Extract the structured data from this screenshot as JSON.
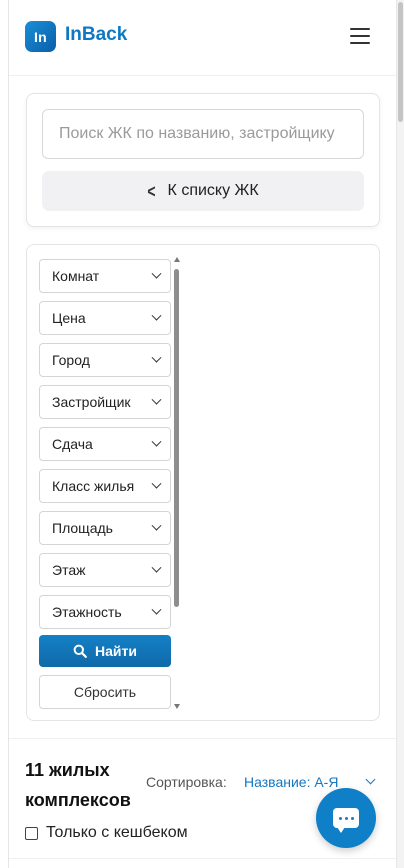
{
  "header": {
    "logo_mark": "In",
    "logo_text": "InBack"
  },
  "search": {
    "placeholder": "Поиск ЖК по названию, застройщику",
    "back_label": "К списку ЖК"
  },
  "filters": {
    "items": [
      {
        "label": "Комнат"
      },
      {
        "label": "Цена"
      },
      {
        "label": "Город"
      },
      {
        "label": "Застройщик"
      },
      {
        "label": "Сдача"
      },
      {
        "label": "Класс жилья"
      },
      {
        "label": "Площадь"
      },
      {
        "label": "Этаж"
      },
      {
        "label": "Этажность"
      }
    ],
    "find_label": "Найти",
    "reset_label": "Сбросить"
  },
  "results": {
    "count_text": "11 жилых комплексов",
    "sort_label": "Сортировка:",
    "sort_value": "Название: А-Я",
    "cashback_label": "Только с кешбеком"
  },
  "colors": {
    "accent": "#0f78c5",
    "button_primary": "#1580c6",
    "muted_bg": "#f1f1f3"
  },
  "icons": {
    "logo": "inback-logo-icon",
    "menu": "hamburger-menu-icon",
    "back": "chevron-left-icon",
    "dropdown": "chevron-down-icon",
    "find": "search-icon",
    "chat": "chat-bubble-icon"
  }
}
